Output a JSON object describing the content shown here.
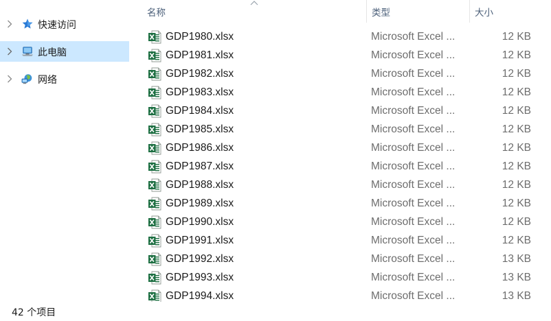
{
  "navigation": {
    "items": [
      {
        "label": "快速访问",
        "icon": "star-icon",
        "selected": false
      },
      {
        "label": "此电脑",
        "icon": "computer-icon",
        "selected": true
      },
      {
        "label": "网络",
        "icon": "network-icon",
        "selected": false
      }
    ]
  },
  "columns": {
    "name": "名称",
    "type": "类型",
    "size": "大小",
    "sorted_by": "name",
    "sort_direction": "ascending"
  },
  "files": [
    {
      "name": "GDP1980.xlsx",
      "type": "Microsoft Excel ...",
      "size": "12 KB"
    },
    {
      "name": "GDP1981.xlsx",
      "type": "Microsoft Excel ...",
      "size": "12 KB"
    },
    {
      "name": "GDP1982.xlsx",
      "type": "Microsoft Excel ...",
      "size": "12 KB"
    },
    {
      "name": "GDP1983.xlsx",
      "type": "Microsoft Excel ...",
      "size": "12 KB"
    },
    {
      "name": "GDP1984.xlsx",
      "type": "Microsoft Excel ...",
      "size": "12 KB"
    },
    {
      "name": "GDP1985.xlsx",
      "type": "Microsoft Excel ...",
      "size": "12 KB"
    },
    {
      "name": "GDP1986.xlsx",
      "type": "Microsoft Excel ...",
      "size": "12 KB"
    },
    {
      "name": "GDP1987.xlsx",
      "type": "Microsoft Excel ...",
      "size": "12 KB"
    },
    {
      "name": "GDP1988.xlsx",
      "type": "Microsoft Excel ...",
      "size": "12 KB"
    },
    {
      "name": "GDP1989.xlsx",
      "type": "Microsoft Excel ...",
      "size": "12 KB"
    },
    {
      "name": "GDP1990.xlsx",
      "type": "Microsoft Excel ...",
      "size": "12 KB"
    },
    {
      "name": "GDP1991.xlsx",
      "type": "Microsoft Excel ...",
      "size": "12 KB"
    },
    {
      "name": "GDP1992.xlsx",
      "type": "Microsoft Excel ...",
      "size": "13 KB"
    },
    {
      "name": "GDP1993.xlsx",
      "type": "Microsoft Excel ...",
      "size": "13 KB"
    },
    {
      "name": "GDP1994.xlsx",
      "type": "Microsoft Excel ...",
      "size": "13 KB"
    }
  ],
  "status_bar": {
    "item_count": "42 个项目"
  },
  "colors": {
    "selection": "#cce8ff",
    "header_text": "#4c607a",
    "secondary_text": "#6d6d6d",
    "excel_green": "#1d6f42"
  }
}
